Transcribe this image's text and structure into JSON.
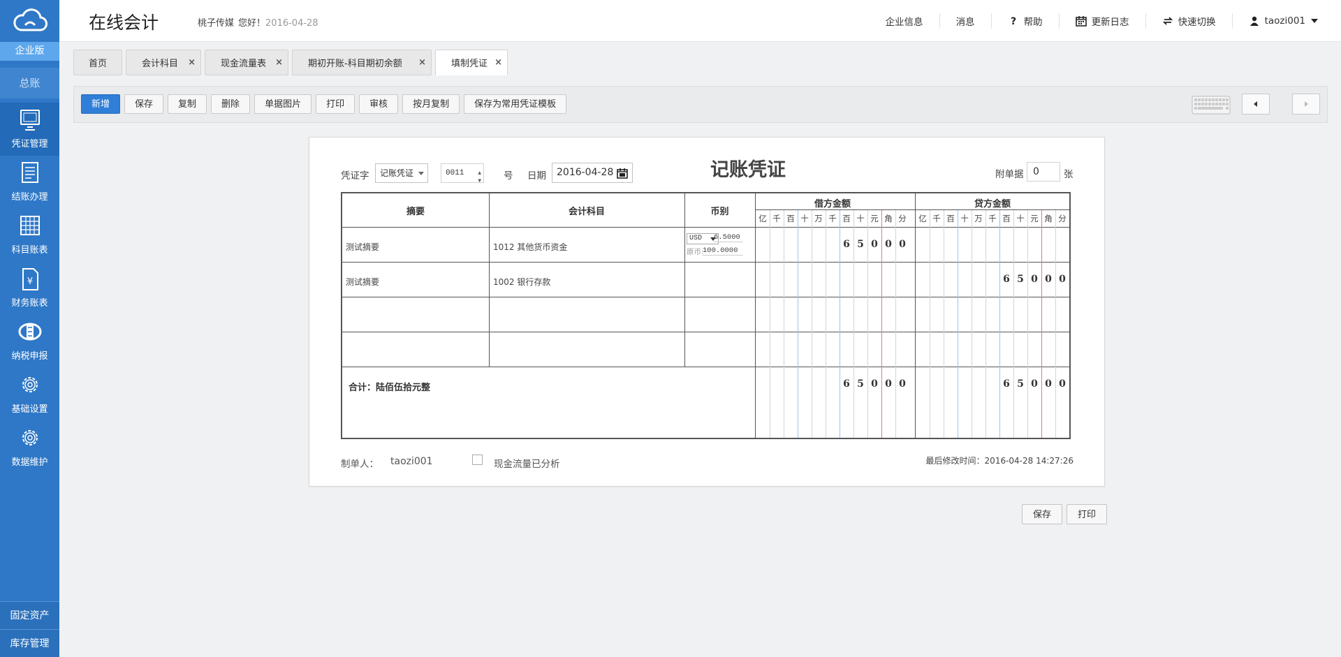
{
  "sidebar": {
    "edition": "企业版",
    "ledger": "总账",
    "items": [
      {
        "label": "凭证管理",
        "icon": "monitor-icon"
      },
      {
        "label": "结账办理",
        "icon": "document-list-icon"
      },
      {
        "label": "科目账表",
        "icon": "table-icon"
      },
      {
        "label": "财务账表",
        "icon": "yen-document-icon"
      },
      {
        "label": "纳税申报",
        "icon": "tax-emblem-icon"
      },
      {
        "label": "基础设置",
        "icon": "gear-icon"
      },
      {
        "label": "数据维护",
        "icon": "gear-icon"
      }
    ],
    "bottom": [
      "固定资产",
      "库存管理"
    ]
  },
  "header": {
    "title": "在线会计",
    "company": "桃子传媒",
    "greeting": "您好！",
    "date": "2016-04-28",
    "menu": {
      "company_info": "企业信息",
      "messages": "消息",
      "help": "帮助",
      "changelog": "更新日志",
      "quick_switch": "快速切换",
      "user": "taozi001"
    }
  },
  "tabs": [
    {
      "label": "首页"
    },
    {
      "label": "会计科目"
    },
    {
      "label": "现金流量表"
    },
    {
      "label": "期初开账-科目期初余额"
    },
    {
      "label": "填制凭证"
    }
  ],
  "toolbar": {
    "buttons": [
      "新增",
      "保存",
      "复制",
      "删除",
      "单据图片",
      "打印",
      "审核",
      "按月复制",
      "保存为常用凭证模板"
    ]
  },
  "voucher": {
    "word_label": "凭证字",
    "word_value": "记账凭证",
    "number": "0011",
    "number_suffix": "号",
    "date_label": "日期",
    "date_value": "2016-04-28",
    "title": "记账凭证",
    "attach_label": "附单据",
    "attach_count": "0",
    "attach_unit": "张",
    "columns": {
      "summary": "摘要",
      "account": "会计科目",
      "currency": "币别",
      "debit": "借方金额",
      "credit": "贷方金额"
    },
    "digit_units": [
      "亿",
      "千",
      "百",
      "十",
      "万",
      "千",
      "百",
      "十",
      "元",
      "角",
      "分"
    ],
    "rows": [
      {
        "summary": "测试摘要",
        "account": "1012 其他货币资金",
        "currency_code": "USD",
        "rate": "6.5000",
        "orig_label": "原币:",
        "orig_amount": "100.0000",
        "debit_digits": [
          "6",
          "5",
          "0",
          "0",
          "0"
        ],
        "credit_digits": []
      },
      {
        "summary": "测试摘要",
        "account": "1002 银行存款",
        "currency_code": "",
        "rate": "",
        "orig_label": "",
        "orig_amount": "",
        "debit_digits": [],
        "credit_digits": [
          "6",
          "5",
          "0",
          "0",
          "0"
        ]
      },
      {
        "summary": "",
        "account": "",
        "debit_digits": [],
        "credit_digits": []
      },
      {
        "summary": "",
        "account": "",
        "debit_digits": [],
        "credit_digits": []
      }
    ],
    "total_label": "合计：陆佰伍拾元整",
    "total_debit_digits": [
      "6",
      "5",
      "0",
      "0",
      "0"
    ],
    "total_credit_digits": [
      "6",
      "5",
      "0",
      "0",
      "0"
    ],
    "maker_label": "制单人：",
    "maker": "taozi001",
    "cashflow_label": "现金流量已分析",
    "modified": "最后修改时间：2016-04-28 14:27:26"
  },
  "actions": {
    "save": "保存",
    "print": "打印"
  },
  "colors": {
    "sidebar": "#2f78c7",
    "primary_button": "#2f7ed8",
    "blue_divider": "#9cc4ea",
    "red_divider": "#e27a7a"
  }
}
